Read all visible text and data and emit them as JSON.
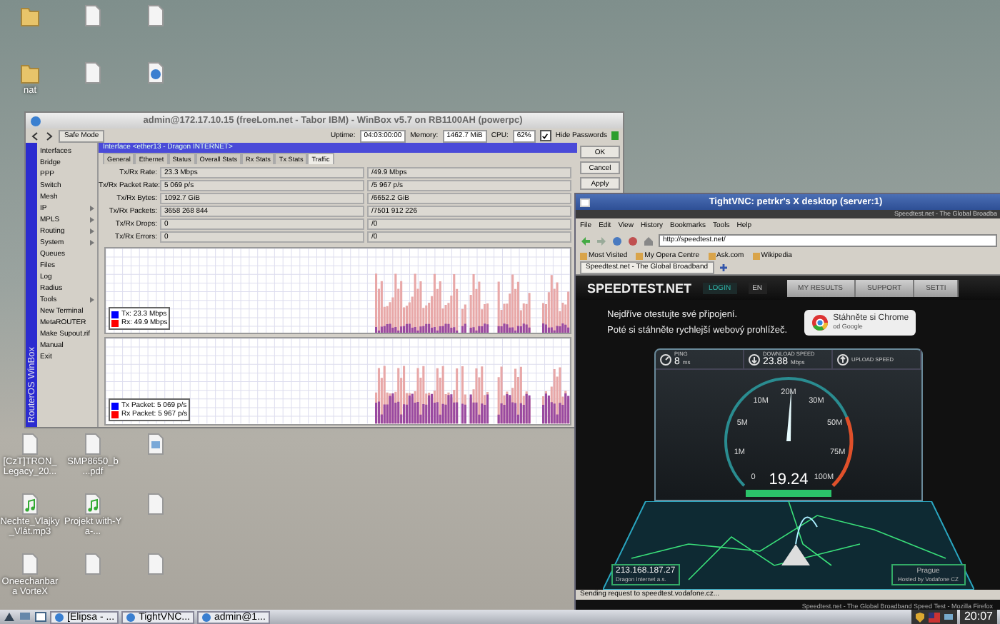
{
  "desktop_icons_top": [
    {
      "kind": "folder"
    },
    {
      "kind": "file"
    },
    {
      "kind": "file"
    },
    {
      "kind": "folder",
      "label": "nat"
    },
    {
      "kind": "file"
    },
    {
      "kind": "web"
    }
  ],
  "desktop_icons_bottom": [
    {
      "kind": "file",
      "label": "[CzT]TRON_ Legacy_20..."
    },
    {
      "kind": "file",
      "label": "SMP8650_b ...pdf"
    },
    {
      "kind": "image"
    },
    {
      "kind": "audio",
      "label": "Nechte_Vlajky_Vlát.mp3"
    },
    {
      "kind": "audio",
      "label": "Projekt with-Ya-..."
    },
    {
      "kind": "file"
    },
    {
      "kind": "file",
      "label": "Oneechanbara VorteX"
    },
    {
      "kind": "file"
    },
    {
      "kind": "file"
    }
  ],
  "winbox": {
    "title": "admin@172.17.10.15 (freeLom.net - Tabor IBM) - WinBox v5.7 on RB1100AH (powerpc)",
    "safe_mode": "Safe Mode",
    "uptime_label": "Uptime:",
    "uptime": "04:03:00:00",
    "memory_label": "Memory:",
    "memory": "1462.7 MiB",
    "cpu_label": "CPU:",
    "cpu": "62%",
    "hide_passwords": {
      "label": "Hide Passwords",
      "checked": true
    },
    "brand": "RouterOS WinBox",
    "menu": [
      {
        "label": "Interfaces",
        "submenu": false
      },
      {
        "label": "Bridge",
        "submenu": false
      },
      {
        "label": "PPP",
        "submenu": false
      },
      {
        "label": "Switch",
        "submenu": false
      },
      {
        "label": "Mesh",
        "submenu": false
      },
      {
        "label": "IP",
        "submenu": true
      },
      {
        "label": "MPLS",
        "submenu": true
      },
      {
        "label": "Routing",
        "submenu": true
      },
      {
        "label": "System",
        "submenu": true
      },
      {
        "label": "Queues",
        "submenu": false
      },
      {
        "label": "Files",
        "submenu": false
      },
      {
        "label": "Log",
        "submenu": false
      },
      {
        "label": "Radius",
        "submenu": false
      },
      {
        "label": "Tools",
        "submenu": true
      },
      {
        "label": "New Terminal",
        "submenu": false
      },
      {
        "label": "MetaROUTER",
        "submenu": false
      },
      {
        "label": "Make Supout.rif",
        "submenu": false
      },
      {
        "label": "Manual",
        "submenu": false
      },
      {
        "label": "Exit",
        "submenu": false
      }
    ],
    "dialog": {
      "title": "Interface <ether13 - Dragon INTERNET>",
      "tabs": [
        {
          "label": "General",
          "selected": false
        },
        {
          "label": "Ethernet",
          "selected": false
        },
        {
          "label": "Status",
          "selected": false
        },
        {
          "label": "Overall Stats",
          "selected": false
        },
        {
          "label": "Rx Stats",
          "selected": false
        },
        {
          "label": "Tx Stats",
          "selected": false
        },
        {
          "label": "Traffic",
          "selected": true
        }
      ],
      "fields": [
        {
          "label": "Tx/Rx Rate:",
          "tx": "23.3 Mbps",
          "rx": "/49.9 Mbps"
        },
        {
          "label": "Tx/Rx Packet Rate:",
          "tx": "5 069 p/s",
          "rx": "/5 967 p/s"
        },
        {
          "label": "Tx/Rx Bytes:",
          "tx": "1092.7 GiB",
          "rx": "/6652.2 GiB"
        },
        {
          "label": "Tx/Rx Packets:",
          "tx": "3658 268 844",
          "rx": "/7501 912 226"
        },
        {
          "label": "Tx/Rx Drops:",
          "tx": "0",
          "rx": "/0"
        },
        {
          "label": "Tx/Rx Errors:",
          "tx": "0",
          "rx": "/0"
        }
      ],
      "graphs": [
        {
          "legend": [
            {
              "label": "Tx: 23.3 Mbps",
              "color": "#0000ff"
            },
            {
              "label": "Rx: 49.9 Mbps",
              "color": "#ff0000"
            }
          ]
        },
        {
          "legend": [
            {
              "label": "Tx Packet: 5 069 p/s",
              "color": "#0000ff"
            },
            {
              "label": "Rx Packet: 5 967 p/s",
              "color": "#ff0000"
            }
          ]
        }
      ],
      "buttons": [
        "OK",
        "Cancel",
        "Apply"
      ]
    }
  },
  "vnc": {
    "title": "TightVNC: petrkr's X desktop (server:1)",
    "window_title": "Speedtest.net - The Global Broadba",
    "menu": [
      "File",
      "Edit",
      "View",
      "History",
      "Bookmarks",
      "Tools",
      "Help"
    ],
    "url": "http://speedtest.net/",
    "bookmarks": [
      "Most Visited",
      "My Opera Centre",
      "Ask.com",
      "Wikipedia"
    ],
    "tab": "Speedtest.net - The Global Broadband",
    "site": {
      "logo": "SPEEDTEST.NET",
      "login": "LOGIN",
      "lang": "EN",
      "nav": [
        "MY RESULTS",
        "SUPPORT",
        "SETTI"
      ],
      "promo": [
        "Nejdříve otestujte své připojení.",
        "Poté si stáhněte rychlejší webový prohlížeč."
      ],
      "chrome_title": "Stáhněte si Chrome",
      "chrome_sub": "od Google",
      "stats": [
        {
          "kind": "ping",
          "label": "PING",
          "value": "8",
          "unit": "ms"
        },
        {
          "kind": "download",
          "label": "DOWNLOAD SPEED",
          "value": "23.88",
          "unit": "Mbps"
        },
        {
          "kind": "upload",
          "label": "UPLOAD SPEED"
        }
      ],
      "gauge_labels": [
        "0",
        "1M",
        "5M",
        "10M",
        "20M",
        "30M",
        "50M",
        "75M",
        "100M"
      ],
      "reading": "19.24",
      "progress": {
        "level": 1
      },
      "ip": "213.168.187.27",
      "isp": "Dragon Internet a.s.",
      "city": "Prague",
      "host": "Hosted by Vodafone CZ"
    },
    "status": "Sending request to speedtest.vodafone.cz...",
    "remote_task": "Speedtest.net - The Global Broadband Speed Test - Mozilla Firefox"
  },
  "taskbar": {
    "tasks": [
      "[Elipsa - ...",
      "TightVNC...",
      "admin@1..."
    ],
    "clock": "20:07"
  }
}
